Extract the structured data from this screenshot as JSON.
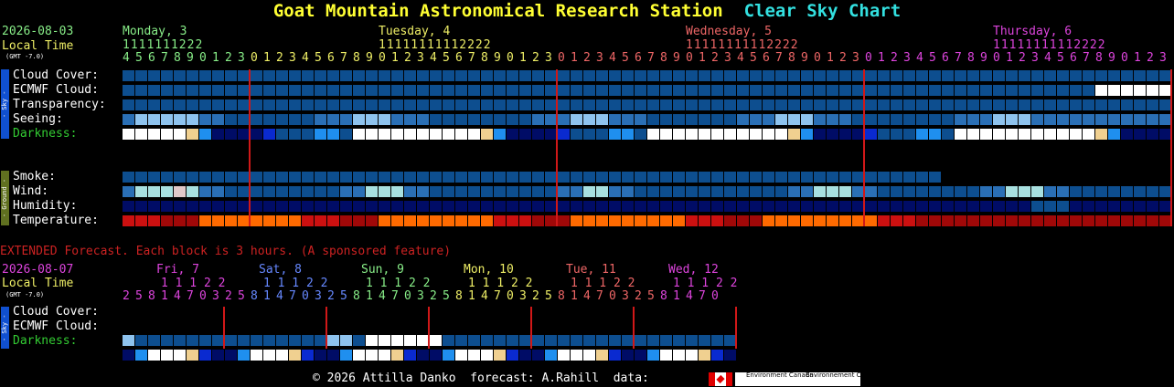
{
  "title": {
    "station": "Goat Mountain Astronomical Research Station",
    "chart": "Clear Sky Chart"
  },
  "main": {
    "date": "2026-08-03",
    "local_time": "Local Time",
    "gmt": "(GMT -7.0)",
    "days": [
      {
        "label": "Monday, 3",
        "color": "#88ee88"
      },
      {
        "label": "Tuesday, 4",
        "color": "#eeee66"
      },
      {
        "label": "Wednesday, 5",
        "color": "#ee6666"
      },
      {
        "label": "Thursday, 6",
        "color": "#dd44dd"
      }
    ],
    "hours_tens": "1111111222           1111111111112222             1111111111112222             1111111111112222",
    "hours_ones": "4567890123012345678901234567890123012345678901234567890123012345678901234567890123",
    "sky_rows": [
      {
        "label": "Cloud Cover:",
        "color": "#ffffff",
        "cells": "BBBBBBBBBBBBBBBBBBBBBBBBBBBBBBBBBBBBBBBBBBBBBBBBBBBBBBBBBBBBBBBBBBBBBBBBBBBBBBBBBBBBB"
      },
      {
        "label": "ECMWF Cloud:",
        "color": "#ffffff",
        "cells": "BBBBBBBBBBBBBBBBBBBBBBBBBBBBBBBBBBBBBBBBBBBBBBBBBBBBBBBBBBBBBBBBBBBBBBBBBBBBWWWWWWWWWBBBBBBBBBBBBBBBBBBLLLLLLLBBB"
      },
      {
        "label": "Transparency:",
        "color": "#ffffff",
        "cells": "BBBBBBBBBBBBBBBBBBBBBBBBBBBBBBBBBBBBBBBBBBBBBBBBBBBBBBBBBBBBBBBBBBBBBBBBBBBBBBBBBBBBBBB"
      },
      {
        "label": "Seeing:",
        "color": "#ffffff",
        "cells": "MLLLLLMMBBBBBBBMMMLLLMMMBBBBBBBBMMMLLLMMMBBBBBBBMMMLLLMMMBBBBBBBBMMMLLLMM"
      },
      {
        "label": "Darkness:",
        "color": "#33cc33",
        "cells": "WWWWWYCNNNNDBBBCCBWWWWWWWWWWYCNNNNDBBBCCBWWWWWWWWWWWYCNNNNDBBBCCBWWWWWWWWWWWYCNNNNDBBB"
      }
    ],
    "ground_rows": [
      {
        "label": "Smoke:",
        "color": "#ffffff",
        "cells": "BBBBBBBBBBBBBBBBBBBBBBBBBBBBBBBBBBBBBBBBBBBBBBBBBBBBBBBBBBBBBBBBBBBBBBBBBBB"
      },
      {
        "label": "Wind:",
        "color": "#ffffff",
        "cells": "MTTTPTMMBBBBBBBBBMMTTTMMBBBBBBBBBBMMTTMMBBBBBBBBBBBBMMTTTMMBBBBBBBBMMTTTMMB"
      },
      {
        "label": "Humidity:",
        "color": "#ffffff",
        "cells": "NNNNNNNNNNNNNNNNNNNNNNNNNNNNNNNNNNNNNNNNNNNNNNNNNNNNNNNNNNNNNNNNNNNNNNNBBBNNNNNNNNNBBB"
      },
      {
        "label": "Temperature:",
        "color": "#ffffff",
        "cells": "RRRrrrOOOOOOOORRRrrrOOOOOOOOORRRrrrOOOOOOOOORRRrrrOOOOOOOOORRRrrr"
      }
    ],
    "sky_tag": "- Sky -",
    "ground_tag": "- Ground -"
  },
  "extended": {
    "notice": "EXTENDED Forecast. Each block is 3 hours. (A sponsored feature)",
    "date": "2026-08-07",
    "local_time": "Local Time",
    "gmt": "(GMT -7.0)",
    "days": [
      {
        "label": "Fri, 7",
        "color": "#dd44dd"
      },
      {
        "label": "Sat, 8",
        "color": "#6688ff"
      },
      {
        "label": "Sun, 9",
        "color": "#88ee88"
      },
      {
        "label": "Mon, 10",
        "color": "#eeee66"
      },
      {
        "label": "Tue, 11",
        "color": "#ee6666"
      },
      {
        "label": "Wed, 12",
        "color": "#dd44dd"
      }
    ],
    "hours_tens": " 11122  11122  11122  11122  11122  11122",
    "hours_ones": "25814703258147032581470325814703258147032581470",
    "rows": [
      {
        "label": "Cloud Cover:",
        "color": "#ffffff"
      },
      {
        "label": "ECMWF Cloud:",
        "color": "#ffffff",
        "cells": "LBBBBBBBBBBBBBBBLLBWWWWWWBBBBBBBBBBBBBBBBBBBBB"
      },
      {
        "label": "Darkness:",
        "color": "#33cc33",
        "cells": "NCWWWYDNNCWWWYDNNCWWWYDNNCWWWYDNNCWWWYDNNCWWWYDN"
      }
    ],
    "sky_tag": "- Sky -"
  },
  "footer": {
    "text": "© 2026 Attilla Danko  forecast: A.Rahill  data:",
    "logo1": "Environment Canada",
    "logo2": "Environnement Canada"
  },
  "colors": {
    "B": "#0d4e8f",
    "M": "#2a6fb5",
    "L": "#8ec3ee",
    "W": "#ffffff",
    "T": "#a8e0e0",
    "P": "#e0c8c8",
    "N": "#000c66",
    "D": "#0a2ad0",
    "C": "#1f8fef",
    "Y": "#f0d090",
    "R": "#cc1010",
    "r": "#a00808",
    "O": "#ff6a00"
  }
}
